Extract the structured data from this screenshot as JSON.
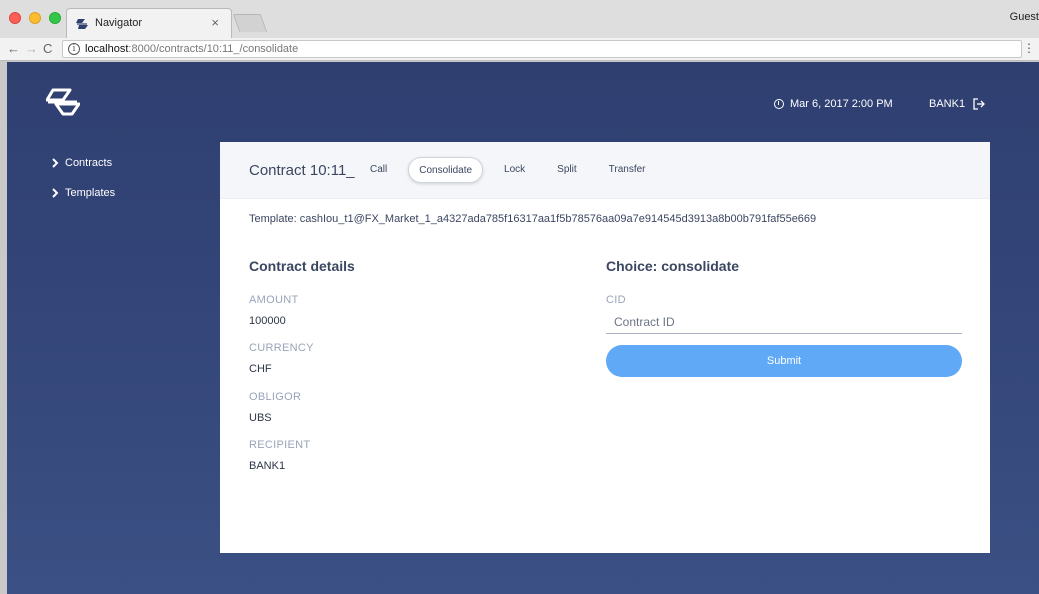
{
  "browser": {
    "tab_title": "Navigator",
    "tab_close": "×",
    "profile": "Guest",
    "url_host": "localhost",
    "url_path": ":8000/contracts/10:11_/consolidate",
    "back": "←",
    "forward": "→",
    "reload": "C",
    "info": "i",
    "menu": "⋮"
  },
  "header": {
    "datetime": "Mar 6, 2017 2:00 PM",
    "user": "BANK1",
    "logo_icon": "navigator-logo-icon"
  },
  "sidebar": {
    "items": [
      {
        "label": "Contracts"
      },
      {
        "label": "Templates"
      }
    ]
  },
  "contract": {
    "title": "Contract 10:11_",
    "tabs": [
      {
        "label": "Call",
        "active": false
      },
      {
        "label": "Consolidate",
        "active": true
      },
      {
        "label": "Lock",
        "active": false
      },
      {
        "label": "Split",
        "active": false
      },
      {
        "label": "Transfer",
        "active": false
      }
    ],
    "template_line": "Template: cashIou_t1@FX_Market_1_a4327ada785f16317aa1f5b78576aa09a7e914545d3913a8b00b791faf55e669",
    "details_title": "Contract details",
    "fields": [
      {
        "label": "AMOUNT",
        "value": "100000"
      },
      {
        "label": "CURRENCY",
        "value": "CHF"
      },
      {
        "label": "OBLIGOR",
        "value": "UBS"
      },
      {
        "label": "RECIPIENT",
        "value": "BANK1"
      }
    ]
  },
  "choice": {
    "title": "Choice: consolidate",
    "field_label": "CID",
    "placeholder": "Contract ID",
    "value": "",
    "submit_label": "Submit"
  },
  "colors": {
    "accent": "#5fa9f7",
    "app_bg": "#34467a",
    "text": "#3b4660"
  }
}
